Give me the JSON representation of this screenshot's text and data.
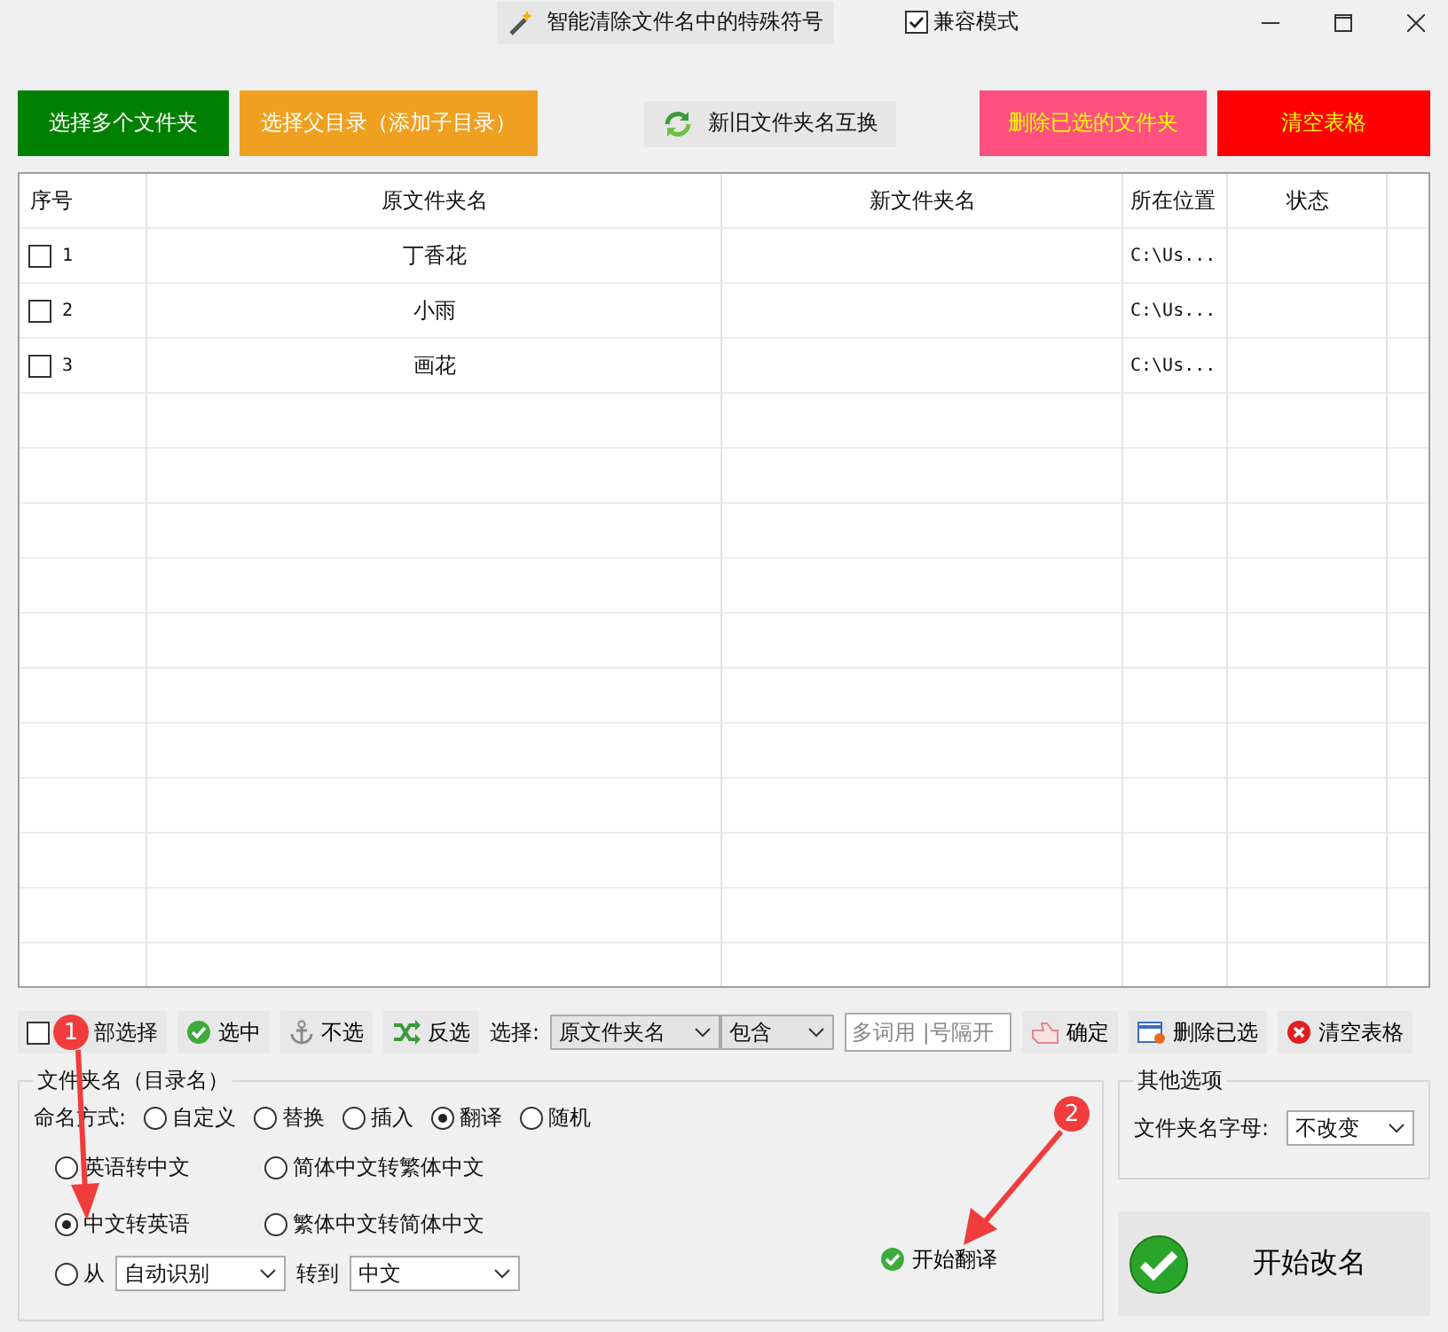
{
  "window": {
    "title": "智能清除文件名中的特殊符号",
    "compat_mode": {
      "label": "兼容模式",
      "checked": true
    }
  },
  "top_buttons": [
    {
      "kind": "add",
      "label": "选择多个文件夹"
    },
    {
      "kind": "add-parent",
      "label": "选择父目录（添加子目录）"
    },
    {
      "kind": "swap",
      "label": "新旧文件夹名互换"
    },
    {
      "kind": "delete",
      "label": "删除已选的文件夹"
    },
    {
      "kind": "clear",
      "label": "清空表格"
    }
  ],
  "table": {
    "columns": [
      "序号",
      "原文件夹名",
      "新文件夹名",
      "所在位置",
      "状态"
    ],
    "rows": [
      {
        "checked": false,
        "index": "1",
        "original": "丁香花",
        "location": "C:\\Us..."
      },
      {
        "checked": false,
        "index": "2",
        "original": "小雨",
        "location": "C:\\Us..."
      },
      {
        "checked": false,
        "index": "3",
        "original": "画花",
        "location": "C:\\Us..."
      }
    ]
  },
  "toolbar": {
    "select_all": {
      "label": "部选择",
      "checked": false
    },
    "buttons": [
      {
        "kind": "select",
        "label": "选中"
      },
      {
        "kind": "deselect",
        "label": "不选"
      },
      {
        "kind": "invert",
        "label": "反选"
      }
    ],
    "filter_label": "选择:",
    "field_dropdown": "原文件夹名",
    "match_dropdown": "包含",
    "keyword_placeholder": "多词用 |号隔开",
    "actions": [
      {
        "kind": "confirm",
        "label": "确定"
      },
      {
        "kind": "delete",
        "label": "删除已选"
      },
      {
        "kind": "clear",
        "label": "清空表格"
      }
    ]
  },
  "naming": {
    "title": "文件夹名（目录名）",
    "mode_label": "命名方式:",
    "modes": [
      {
        "label": "自定义",
        "selected": false
      },
      {
        "label": "替换",
        "selected": false
      },
      {
        "label": "插入",
        "selected": false
      },
      {
        "label": "翻译",
        "selected": true
      },
      {
        "label": "随机",
        "selected": false
      }
    ],
    "translate_options": [
      {
        "label": "英语转中文",
        "selected": false
      },
      {
        "label": "简体中文转繁体中文",
        "selected": false
      },
      {
        "label": "中文转英语",
        "selected": true
      },
      {
        "label": "繁体中文转简体中文",
        "selected": false
      }
    ],
    "custom_option": {
      "label": "从",
      "selected": false,
      "from": "自动识别",
      "to_label": "转到",
      "to": "中文"
    },
    "start_translate": "开始翻译"
  },
  "other": {
    "title": "其他选项",
    "letter_label": "文件夹名字母:",
    "letter_value": "不改变"
  },
  "start_rename": "开始改名",
  "annotations": [
    {
      "label": "1"
    },
    {
      "label": "2"
    }
  ]
}
